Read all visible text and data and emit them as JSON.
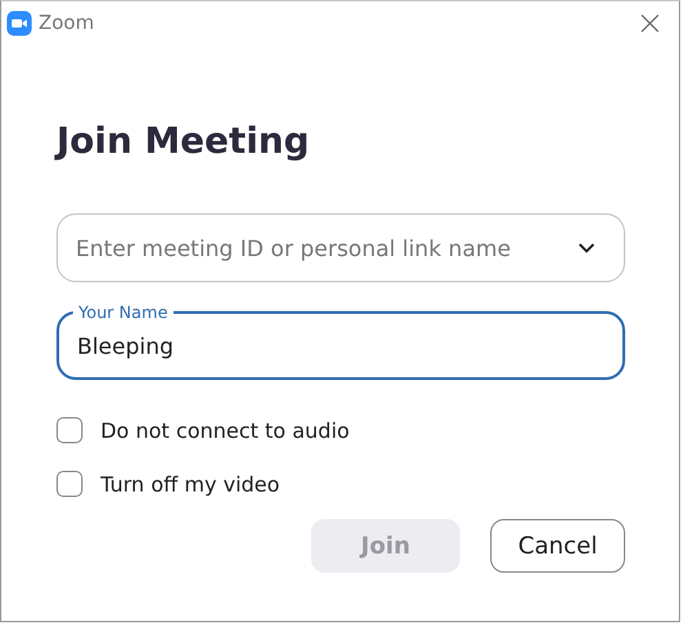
{
  "window": {
    "title": "Zoom"
  },
  "heading": "Join Meeting",
  "meeting_field": {
    "placeholder": "Enter meeting ID or personal link name"
  },
  "name_field": {
    "label": "Your Name",
    "value": "Bleeping",
    "focused": true
  },
  "options": [
    {
      "label": "Do not connect to audio",
      "checked": false
    },
    {
      "label": "Turn off my video",
      "checked": false
    }
  ],
  "buttons": [
    {
      "label": "Join",
      "kind": "primary",
      "disabled": true
    },
    {
      "label": "Cancel",
      "kind": "secondary",
      "disabled": false
    }
  ]
}
